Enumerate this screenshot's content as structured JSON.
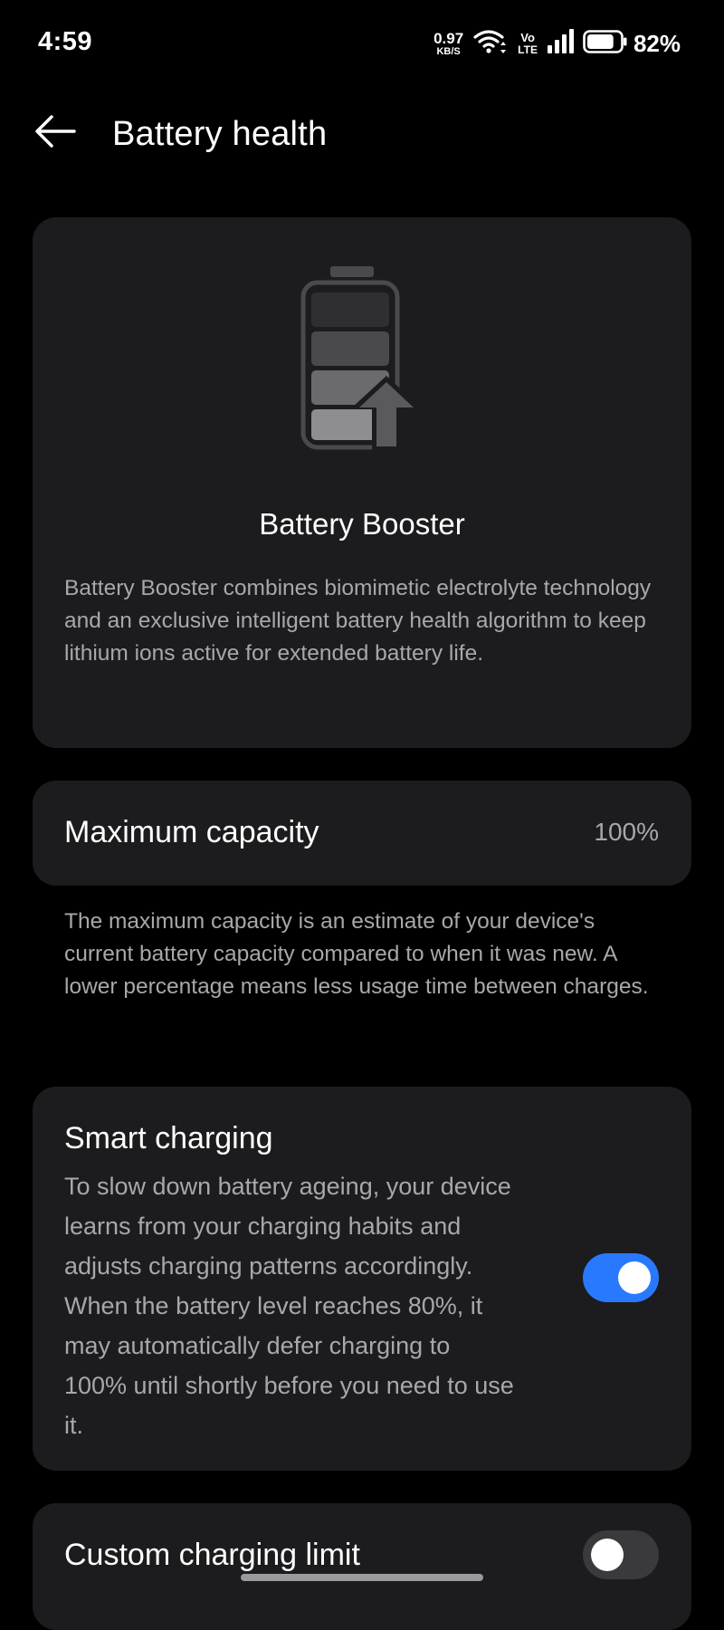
{
  "status_bar": {
    "time": "4:59",
    "net_speed_value": "0.97",
    "net_speed_unit": "KB/S",
    "volte_top": "Vo",
    "volte_bottom": "LTE",
    "battery_percent": "82%",
    "battery_level": 0.82
  },
  "header": {
    "title": "Battery health",
    "back_icon": "arrow-left-icon"
  },
  "booster": {
    "icon": "battery-boost-icon",
    "title": "Battery Booster",
    "description": "Battery Booster combines biomimetic electrolyte technology and an exclusive intelligent battery health algorithm to keep lithium ions active for extended battery life."
  },
  "capacity": {
    "label": "Maximum capacity",
    "value": "100%",
    "note": "The maximum capacity is an estimate of your device's current battery capacity compared to when it was new. A lower percentage means less usage time between charges."
  },
  "smart_charging": {
    "title": "Smart charging",
    "description": "To slow down battery ageing, your device learns from your charging habits and adjusts charging patterns accordingly. When the battery level reaches 80%, it may automatically defer charging to 100% until shortly before you need to use it.",
    "enabled": true
  },
  "custom_limit": {
    "title": "Custom charging limit",
    "enabled": false
  },
  "colors": {
    "background": "#000000",
    "card": "#1c1c1e",
    "secondary_text": "#a8a8ac",
    "accent": "#2979ff",
    "toggle_off": "#3a3a3c"
  }
}
